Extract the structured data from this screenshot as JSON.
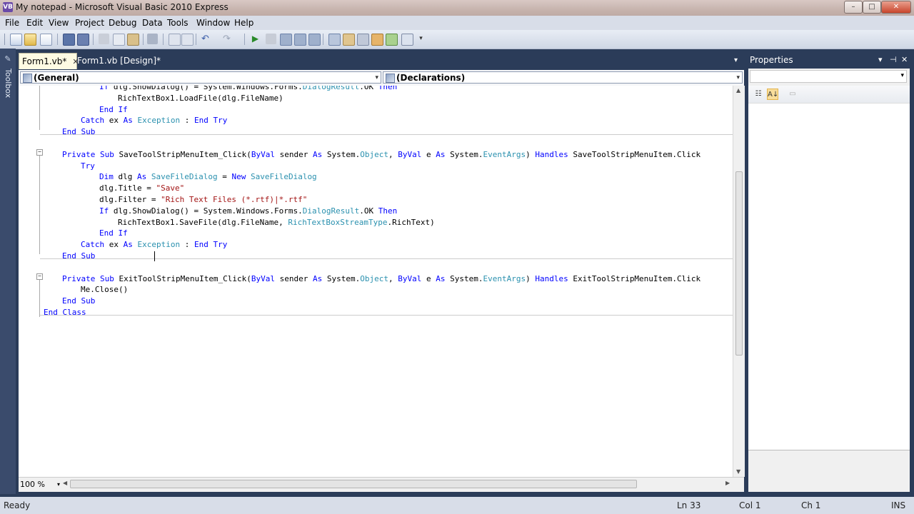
{
  "window": {
    "title": "My notepad - Microsoft Visual Basic 2010 Express",
    "icon_label": "VB",
    "min_glyph": "–",
    "max_glyph": "□",
    "close_glyph": "✕"
  },
  "menu": [
    "File",
    "Edit",
    "View",
    "Project",
    "Debug",
    "Data",
    "Tools",
    "Window",
    "Help"
  ],
  "toolbox": {
    "label": "Toolbox",
    "icon": "wrench-icon"
  },
  "tabs": [
    {
      "label": "Form1.vb*",
      "close": "✕",
      "active": true
    },
    {
      "label": "Form1.vb [Design]*",
      "active": false
    }
  ],
  "tab_dropdown": "▾",
  "navigation": {
    "left_combo": "(General)",
    "right_combo": "(Declarations)",
    "arrow": "▾"
  },
  "code_lines": [
    {
      "indent": 2,
      "tokens": [
        [
          "kw",
          "If "
        ],
        [
          "",
          "dlg.ShowDialog() = System.Windows.Forms."
        ],
        [
          "ty",
          "DialogResult"
        ],
        [
          "",
          ".OK "
        ],
        [
          "kw",
          "Then"
        ]
      ]
    },
    {
      "indent": 3,
      "tokens": [
        [
          "",
          "RichTextBox1.LoadFile(dlg.FileName)"
        ]
      ]
    },
    {
      "indent": 2,
      "tokens": [
        [
          "kw",
          "End If"
        ]
      ]
    },
    {
      "indent": 1,
      "tokens": [
        [
          "kw",
          "Catch "
        ],
        [
          "",
          "ex "
        ],
        [
          "kw",
          "As "
        ],
        [
          "ty",
          "Exception"
        ],
        [
          "",
          " : "
        ],
        [
          "kw",
          "End Try"
        ]
      ]
    },
    {
      "indent": 0,
      "tokens": [
        [
          "kw",
          "End Sub"
        ]
      ]
    },
    {
      "indent": 0,
      "tokens": []
    },
    {
      "indent": 0,
      "tokens": [
        [
          "kw",
          "Private Sub "
        ],
        [
          "",
          "SaveToolStripMenuItem_Click("
        ],
        [
          "kw",
          "ByVal "
        ],
        [
          "",
          "sender "
        ],
        [
          "kw",
          "As "
        ],
        [
          "",
          "System."
        ],
        [
          "ty",
          "Object"
        ],
        [
          "",
          ", "
        ],
        [
          "kw",
          "ByVal "
        ],
        [
          "",
          "e "
        ],
        [
          "kw",
          "As "
        ],
        [
          "",
          "System."
        ],
        [
          "ty",
          "EventArgs"
        ],
        [
          "",
          ") "
        ],
        [
          "kw",
          "Handles "
        ],
        [
          "",
          "SaveToolStripMenuItem.Click"
        ]
      ]
    },
    {
      "indent": 1,
      "tokens": [
        [
          "kw",
          "Try"
        ]
      ]
    },
    {
      "indent": 2,
      "tokens": [
        [
          "kw",
          "Dim "
        ],
        [
          "",
          "dlg "
        ],
        [
          "kw",
          "As "
        ],
        [
          "ty",
          "SaveFileDialog"
        ],
        [
          "",
          " = "
        ],
        [
          "kw",
          "New "
        ],
        [
          "ty",
          "SaveFileDialog"
        ]
      ]
    },
    {
      "indent": 2,
      "tokens": [
        [
          "",
          "dlg.Title = "
        ],
        [
          "st",
          "\"Save\""
        ]
      ]
    },
    {
      "indent": 2,
      "tokens": [
        [
          "",
          "dlg.Filter = "
        ],
        [
          "st",
          "\"Rich Text Files (*.rtf)|*.rtf\""
        ]
      ]
    },
    {
      "indent": 2,
      "tokens": [
        [
          "kw",
          "If "
        ],
        [
          "",
          "dlg.ShowDialog() = System.Windows.Forms."
        ],
        [
          "ty",
          "DialogResult"
        ],
        [
          "",
          ".OK "
        ],
        [
          "kw",
          "Then"
        ]
      ]
    },
    {
      "indent": 3,
      "tokens": [
        [
          "",
          "RichTextBox1.SaveFile(dlg.FileName, "
        ],
        [
          "ty",
          "RichTextBoxStreamType"
        ],
        [
          "",
          ".RichText)"
        ]
      ]
    },
    {
      "indent": 2,
      "tokens": [
        [
          "kw",
          "End If"
        ]
      ]
    },
    {
      "indent": 1,
      "tokens": [
        [
          "kw",
          "Catch "
        ],
        [
          "",
          "ex "
        ],
        [
          "kw",
          "As "
        ],
        [
          "ty",
          "Exception"
        ],
        [
          "",
          " : "
        ],
        [
          "kw",
          "End Try"
        ]
      ]
    },
    {
      "indent": 0,
      "tokens": [
        [
          "kw",
          "End Sub"
        ]
      ]
    },
    {
      "indent": 0,
      "tokens": []
    },
    {
      "indent": 0,
      "tokens": [
        [
          "kw",
          "Private Sub "
        ],
        [
          "",
          "ExitToolStripMenuItem_Click("
        ],
        [
          "kw",
          "ByVal "
        ],
        [
          "",
          "sender "
        ],
        [
          "kw",
          "As "
        ],
        [
          "",
          "System."
        ],
        [
          "ty",
          "Object"
        ],
        [
          "",
          ", "
        ],
        [
          "kw",
          "ByVal "
        ],
        [
          "",
          "e "
        ],
        [
          "kw",
          "As "
        ],
        [
          "",
          "System."
        ],
        [
          "ty",
          "EventArgs"
        ],
        [
          "",
          ") "
        ],
        [
          "kw",
          "Handles "
        ],
        [
          "",
          "ExitToolStripMenuItem.Click"
        ]
      ]
    },
    {
      "indent": 1,
      "tokens": [
        [
          "",
          "Me.Close()"
        ]
      ]
    },
    {
      "indent": 0,
      "tokens": [
        [
          "kw",
          "End Sub"
        ]
      ]
    },
    {
      "indent": -1,
      "tokens": [
        [
          "kw",
          "End Class"
        ]
      ]
    }
  ],
  "editor": {
    "zoom": "100 %",
    "zoom_arrow": "▾",
    "fold_glyph": "−"
  },
  "properties": {
    "title": "Properties",
    "pin_glyph": "▾",
    "autohide_glyph": "⊣",
    "close_glyph": "✕",
    "categorized_glyph": "☷",
    "alpha_glyph": "A↓",
    "pages_glyph": "▭",
    "combo_arrow": "▾"
  },
  "status": {
    "text": "Ready",
    "line": "Ln 33",
    "col": "Col 1",
    "ch": "Ch 1",
    "mode": "INS"
  },
  "colors": {
    "keyword": "#0000ff",
    "type": "#2b91af",
    "string": "#a31515",
    "ide_background": "#2b3c59"
  }
}
